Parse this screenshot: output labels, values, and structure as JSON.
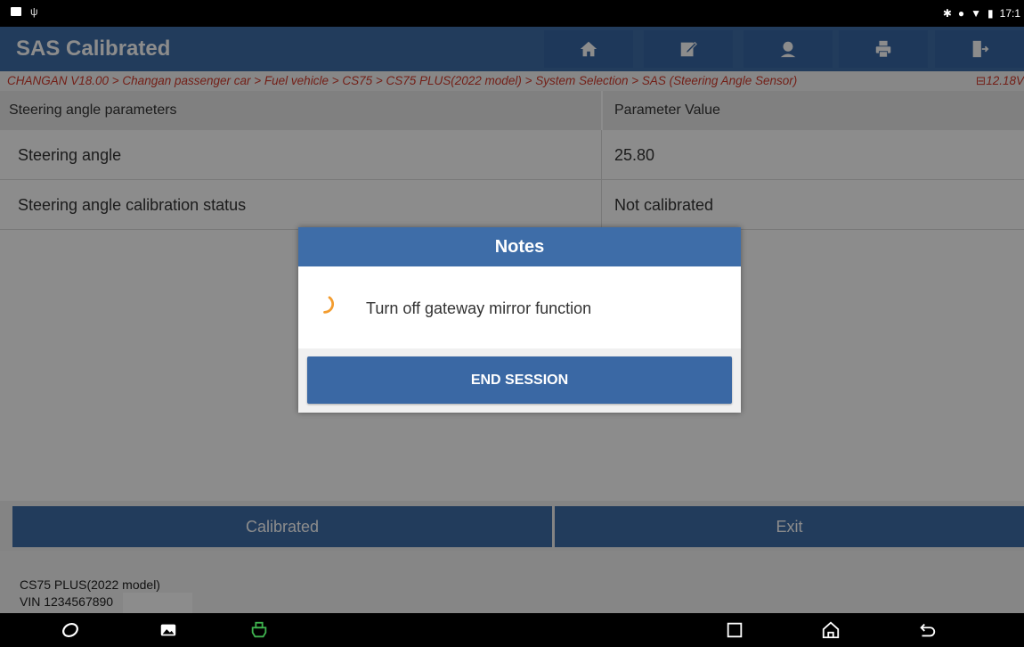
{
  "status_bar": {
    "time": "17:1"
  },
  "header": {
    "title": "SAS Calibrated",
    "buttons": [
      "home-icon",
      "edit-report-icon",
      "user-support-icon",
      "print-icon",
      "exit-icon"
    ]
  },
  "breadcrumb": {
    "path": "CHANGAN V18.00 > Changan passenger car > Fuel vehicle > CS75 > CS75 PLUS(2022 model) > System Selection > SAS (Steering Angle Sensor)",
    "voltage": "12.18V"
  },
  "table": {
    "headers": [
      "Steering angle parameters",
      "Parameter Value"
    ],
    "rows": [
      {
        "name": "Steering angle",
        "value": "25.80"
      },
      {
        "name": "Steering angle calibration status",
        "value": "Not calibrated"
      }
    ]
  },
  "actions": {
    "calibrated": "Calibrated",
    "exit": "Exit"
  },
  "footer": {
    "model": "CS75 PLUS(2022 model)",
    "vin": "VIN 1234567890"
  },
  "dialog": {
    "title": "Notes",
    "message": "Turn off gateway mirror function",
    "button": "END SESSION"
  },
  "colors": {
    "header_blue": "#3e6da8",
    "breadcrumb_red": "#d23a2a",
    "spinner_orange": "#f39c2e",
    "vci_green": "#3fb34f"
  }
}
